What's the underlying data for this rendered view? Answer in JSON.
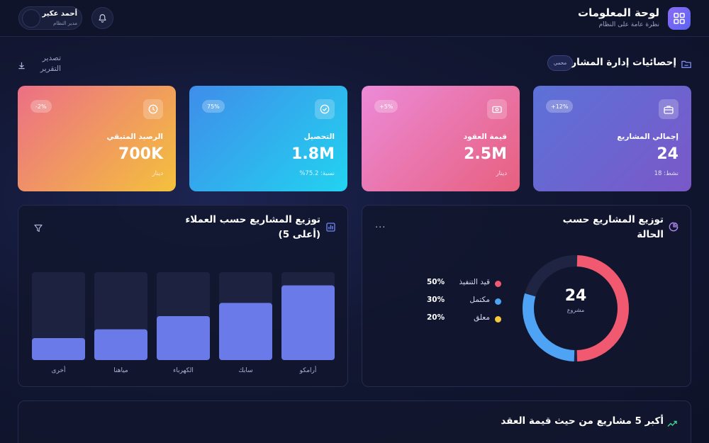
{
  "header": {
    "title": "لوحة المعلومات",
    "subtitle": "نظرة عامة على النظام",
    "brand_icon": "grid-icon",
    "bell_icon": "bell-icon",
    "user": {
      "name": "أحمد عكير",
      "role": "مدير النظام"
    }
  },
  "section": {
    "title": "إحصائيات إدارة المشاريع",
    "icon": "folder-icon",
    "badge": "محمي",
    "export_label": "تصدير التقرير",
    "export_icon": "download-icon"
  },
  "cards": [
    {
      "label": "إجمالي المشاريع",
      "value": "24",
      "note": "نشط: 18",
      "pill": "+12%",
      "icon": "briefcase-icon"
    },
    {
      "label": "قيمة العقود",
      "value": "2.5M",
      "note": "دينار",
      "pill": "+5%",
      "icon": "money-icon"
    },
    {
      "label": "التحصيل",
      "value": "1.8M",
      "note": "نسبة: 75.2%",
      "pill": "75%",
      "icon": "check-circle-icon"
    },
    {
      "label": "الرصيد المتبقي",
      "value": "700K",
      "note": "دينار",
      "pill": "-2%",
      "icon": "clock-icon"
    }
  ],
  "status_panel": {
    "title": "توزيع المشاريع حسب الحالة",
    "icon": "pie-chart-icon",
    "menu": "...",
    "center_value": "24",
    "center_caption": "مشروع"
  },
  "clients_panel": {
    "title": "توزيع المشاريع حسب العملاء (أعلى 5)",
    "icon": "bar-chart-icon",
    "filter_icon": "filter-icon"
  },
  "top_panel": {
    "title": "أكبر 5 مشاريع من حيث قيمة العقد",
    "icon": "trending-up-icon"
  },
  "colors": {
    "in_progress": "#f0596f",
    "completed": "#4ea3f5",
    "suspended": "#f5c83c",
    "bar": "#6a7ae8",
    "bar_track": "#1d2240"
  },
  "chart_data": [
    {
      "type": "pie",
      "title": "توزيع المشاريع حسب الحالة",
      "categories": [
        "قيد التنفيذ",
        "مكتمل",
        "معلق"
      ],
      "values": [
        50,
        30,
        20
      ],
      "value_labels": [
        "50%",
        "30%",
        "20%"
      ],
      "colors": [
        "#f0596f",
        "#4ea3f5",
        "#f5c83c"
      ],
      "legend": "left"
    },
    {
      "type": "bar",
      "title": "توزيع المشاريع حسب العملاء (أعلى 5)",
      "categories": [
        "أرامكو",
        "سابك",
        "الكهرباء",
        "مياهنا",
        "أخرى"
      ],
      "values": [
        85,
        65,
        50,
        35,
        25
      ],
      "ylim": [
        0,
        100
      ],
      "grid": false
    }
  ]
}
